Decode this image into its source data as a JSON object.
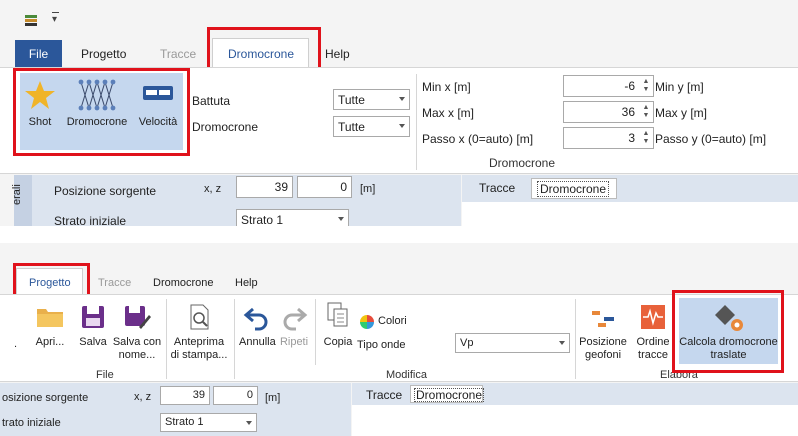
{
  "top": {
    "tabs": {
      "file": "File",
      "progetto": "Progetto",
      "tracce": "Tracce",
      "dromocrone": "Dromocrone",
      "help": "Help"
    },
    "buttons": {
      "shot": "Shot",
      "dromocrone": "Dromocrone",
      "velocita": "Velocità"
    },
    "filters": {
      "battuta_label": "Battuta",
      "battuta_value": "Tutte",
      "dromocrone_label": "Dromocrone",
      "dromocrone_value": "Tutte"
    },
    "axes": {
      "min_x_label": "Min x [m]",
      "min_x_value": "-6",
      "max_x_label": "Max x [m]",
      "max_x_value": "36",
      "passo_x_label": "Passo x (0=auto) [m]",
      "passo_x_value": "3",
      "min_y_label": "Min y [m]",
      "max_y_label": "Max y [m]",
      "passo_y_label": "Passo y (0=auto) [m]"
    },
    "group_label": "Dromocrone",
    "panel": {
      "side_tab": "erali",
      "posizione_label": "Posizione sorgente",
      "xz_label": "x, z",
      "x_value": "39",
      "z_value": "0",
      "unit": "[m]",
      "strato_label": "Strato iniziale",
      "strato_value": "Strato 1"
    },
    "view_tabs": {
      "tracce": "Tracce",
      "dromocrone": "Dromocrone"
    }
  },
  "bottom": {
    "tabs": {
      "progetto": "Progetto",
      "tracce": "Tracce",
      "dromocrone": "Dromocrone",
      "help": "Help"
    },
    "buttons": {
      "apri": "Apri...",
      "salva": "Salva",
      "salva_con_nome": "Salva con nome...",
      "anteprima": "Anteprima di stampa...",
      "annulla": "Annulla",
      "ripeti": "Ripeti",
      "copia": "Copia",
      "colori": "Colori",
      "tipo_onde_label": "Tipo onde",
      "tipo_onde_value": "Vp",
      "posizione_geofoni": "Posizione geofoni",
      "ordine_tracce": "Ordine tracce",
      "calcola": "Calcola dromocrone traslate"
    },
    "groups": {
      "file": "File",
      "modifica": "Modifica",
      "elabora": "Elabora"
    },
    "panel": {
      "posizione_label": "osizione sorgente",
      "xz_label": "x, z",
      "x_value": "39",
      "z_value": "0",
      "unit": "[m]",
      "strato_label": "trato iniziale",
      "strato_value": "Strato 1"
    },
    "view_tabs": {
      "tracce": "Tracce",
      "dromocrone": "Dromocrone"
    }
  }
}
